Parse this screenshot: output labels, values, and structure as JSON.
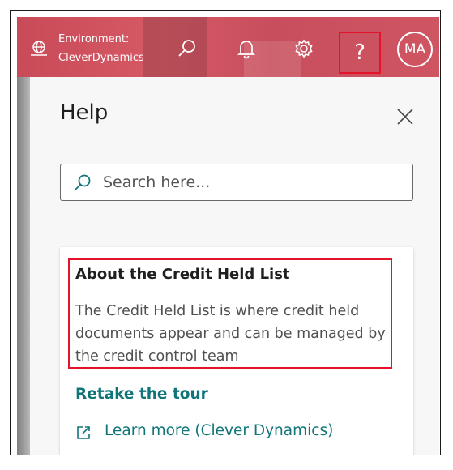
{
  "header": {
    "environment_label": "Environment:",
    "environment_value": "CleverDynamics",
    "help_icon_glyph": "?",
    "avatar_initials": "MA",
    "accent_color": "#cc515f"
  },
  "help_pane": {
    "title": "Help",
    "search_placeholder": "Search here...",
    "card": {
      "title": "About the Credit Held List",
      "body": "The Credit Held List is where credit held documents appear and can be managed by the credit control team"
    },
    "tour_link": "Retake the tour",
    "learn_more_link": "Learn more (Clever Dynamics)",
    "link_color": "#0f7579",
    "highlight_color": "#e3132a"
  }
}
